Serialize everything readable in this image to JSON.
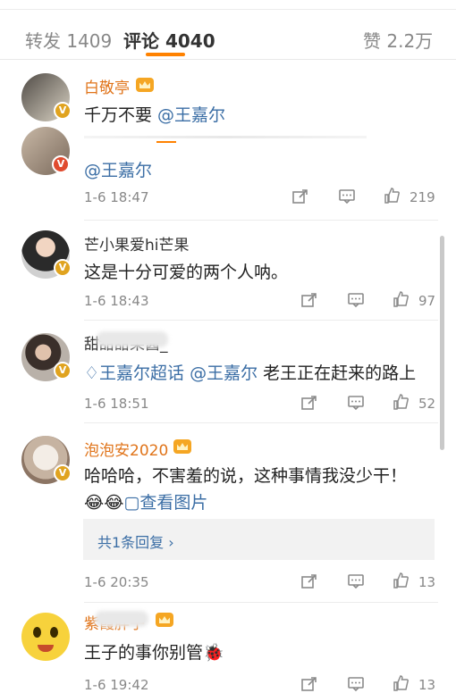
{
  "tabs": {
    "repost": "转发 1409",
    "comment": "评论 4040",
    "like": "赞 2.2万"
  },
  "colors": {
    "accent": "#ff8200",
    "vip_name": "#e0741a",
    "mention": "#3b6ea5",
    "badge": "#e0a31f"
  },
  "pinned": {
    "username": "白敬亭",
    "text": "千万不要 ",
    "mention": "@王嘉尔"
  },
  "comments": [
    {
      "mention": "@王嘉尔",
      "time": "1-6 18:47",
      "likes": "219"
    },
    {
      "username": "芒小果爱hi芒果",
      "text": "这是十分可爱的两个人呐。",
      "time": "1-6 18:43",
      "likes": "97"
    },
    {
      "username": "甜甜甜果酱_",
      "text_part1": "王嘉尔超话 @王嘉尔",
      "text_part2": " 老王正在赶来的路上",
      "time": "1-6 18:51",
      "likes": "52"
    },
    {
      "username": "泡泡安2020",
      "text": "哈哈哈，不害羞的说，这种事情我没少干！",
      "emoji": "😂😂",
      "view_image": "查看图片",
      "reply_link": "共1条回复 ›",
      "time": "1-6 20:35",
      "likes": "13"
    },
    {
      "username": "紫霞胖子",
      "text": "王子的事你别管🐞",
      "time": "1-6 19:42",
      "likes": "13"
    }
  ]
}
